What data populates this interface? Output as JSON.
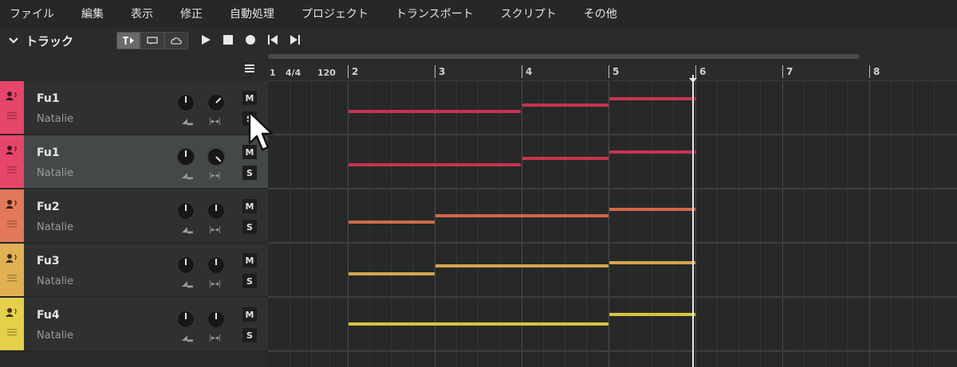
{
  "menu": [
    "ファイル",
    "編集",
    "表示",
    "修正",
    "自動処理",
    "プロジェクト",
    "トランスポート",
    "スクリプト",
    "その他"
  ],
  "track_header": {
    "title": "トラック",
    "modes": [
      "note-mode-icon",
      "loop-mode-icon",
      "cloud-mode-icon"
    ],
    "transport": [
      "play-icon",
      "stop-icon",
      "record-icon",
      "skip-start-icon",
      "skip-end-icon"
    ]
  },
  "ruler": {
    "start": "1",
    "time_signature": "4/4",
    "tempo": "120",
    "measures": [
      "2",
      "3",
      "4",
      "5",
      "6",
      "7",
      "8"
    ]
  },
  "tracks": [
    {
      "name": "Fu1",
      "singer": "Natalie",
      "color": "#e5466a",
      "mute": "M",
      "solo": "S",
      "selected": false,
      "notes_color": "#c8334f"
    },
    {
      "name": "Fu1",
      "singer": "Natalie",
      "color": "#e5466a",
      "mute": "M",
      "solo": "S",
      "selected": true,
      "notes_color": "#c8334f"
    },
    {
      "name": "Fu2",
      "singer": "Natalie",
      "color": "#e2795a",
      "mute": "M",
      "solo": "S",
      "selected": false,
      "notes_color": "#d0674a"
    },
    {
      "name": "Fu3",
      "singer": "Natalie",
      "color": "#e0b052",
      "mute": "M",
      "solo": "S",
      "selected": false,
      "notes_color": "#d4a64a"
    },
    {
      "name": "Fu4",
      "singer": "Natalie",
      "color": "#e6cf4a",
      "mute": "M",
      "solo": "S",
      "selected": false,
      "notes_color": "#d9c23f"
    }
  ],
  "knob_labels": {
    "volume": "◢▂",
    "pan": "|▸◂|"
  }
}
